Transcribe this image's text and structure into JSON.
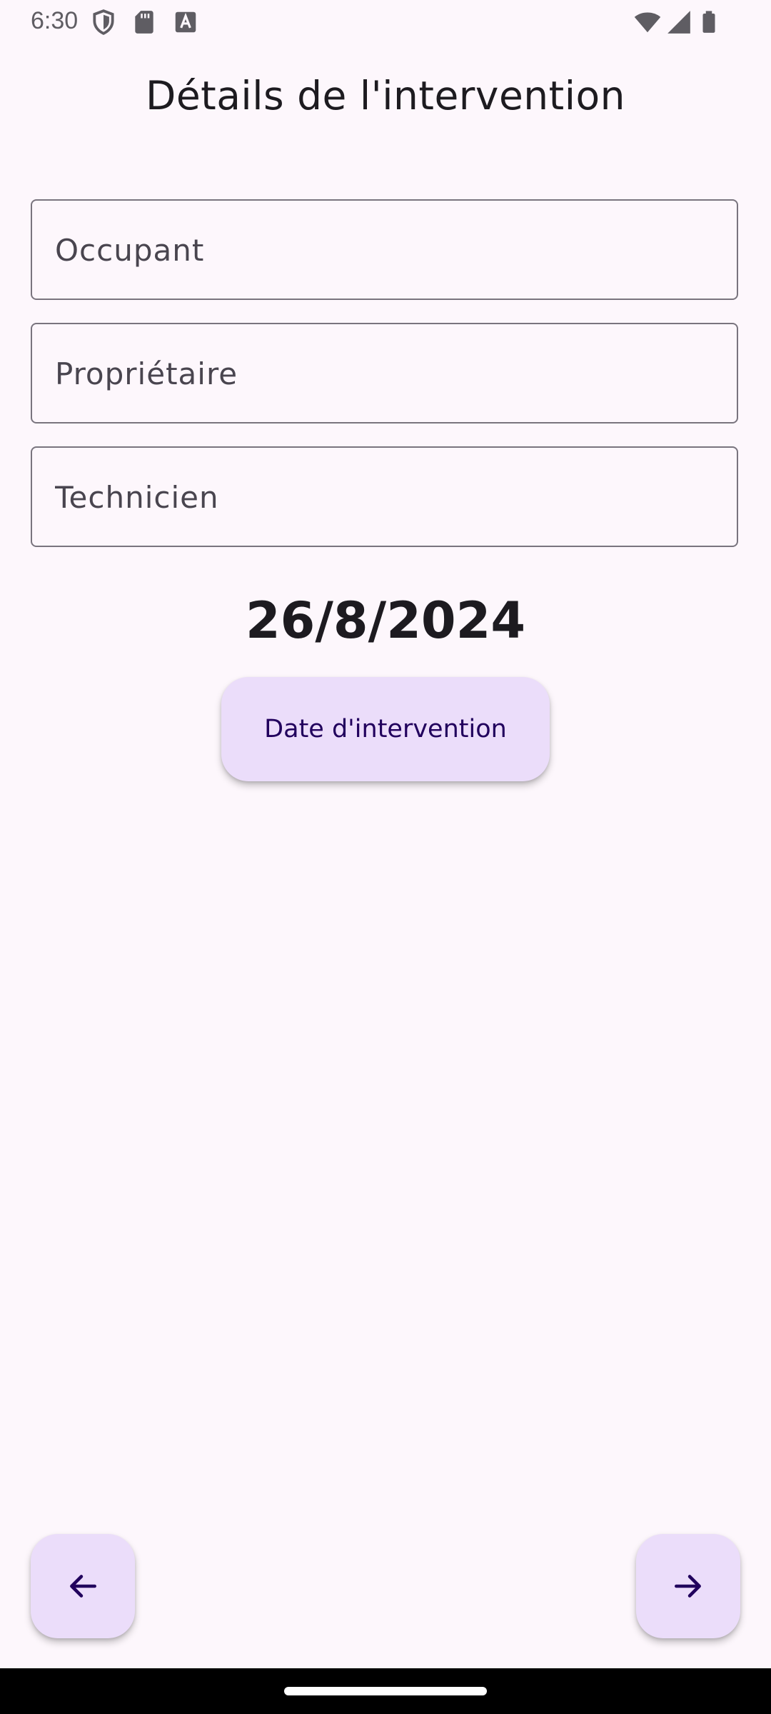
{
  "status_bar": {
    "time": "6:30",
    "icons_left": [
      "shield-icon",
      "sd-card-icon",
      "text-a-icon"
    ],
    "icons_right": [
      "wifi-icon",
      "signal-icon",
      "battery-icon"
    ]
  },
  "page": {
    "title": "Détails de l'intervention"
  },
  "form": {
    "occupant_placeholder": "Occupant",
    "occupant_value": "",
    "proprietaire_placeholder": "Propriétaire",
    "proprietaire_value": "",
    "technicien_placeholder": "Technicien",
    "technicien_value": ""
  },
  "date": {
    "value": "26/8/2024",
    "button_label": "Date d'intervention"
  },
  "navigation": {
    "back_icon": "arrow-left-icon",
    "next_icon": "arrow-right-icon"
  },
  "colors": {
    "background": "#fdf7fc",
    "button_background": "#ebddfa",
    "button_text": "#21005d",
    "field_border": "#79747e",
    "title_text": "#1d1b20"
  }
}
